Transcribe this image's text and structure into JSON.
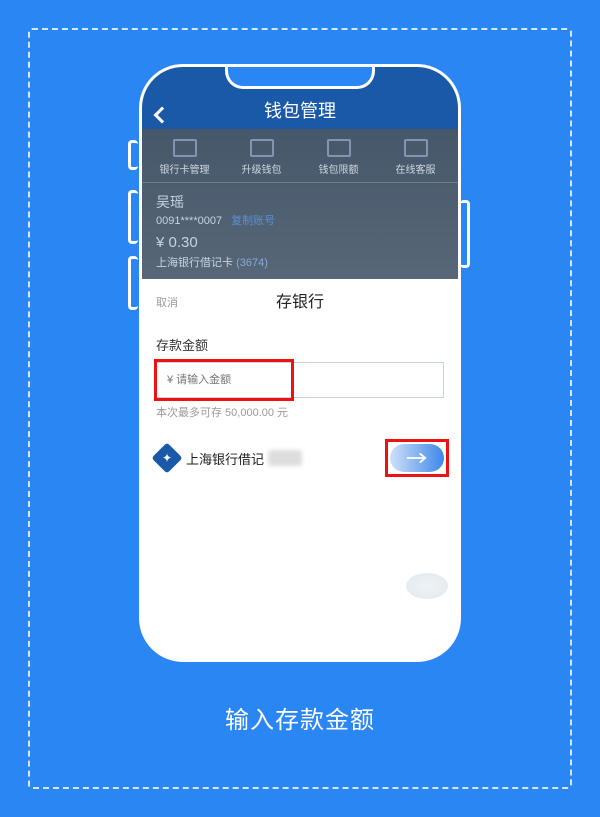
{
  "navbar": {
    "title": "钱包管理"
  },
  "menu": {
    "items": [
      {
        "label": "银行卡管理"
      },
      {
        "label": "升级钱包"
      },
      {
        "label": "钱包限额"
      },
      {
        "label": "在线客服"
      }
    ]
  },
  "user": {
    "name": "吴瑶",
    "account": "0091****0007",
    "copy_label": "复制账号",
    "balance": "¥ 0.30",
    "card": "上海银行借记卡",
    "card_num": "(3674)"
  },
  "sheet": {
    "cancel": "取消",
    "title": "存银行",
    "amount_label": "存款金额",
    "input_placeholder": "¥ 请输入金额",
    "hint": "本次最多可存 50,000.00 元",
    "bank_name": "上海银行借记"
  },
  "caption": "输入存款金额"
}
